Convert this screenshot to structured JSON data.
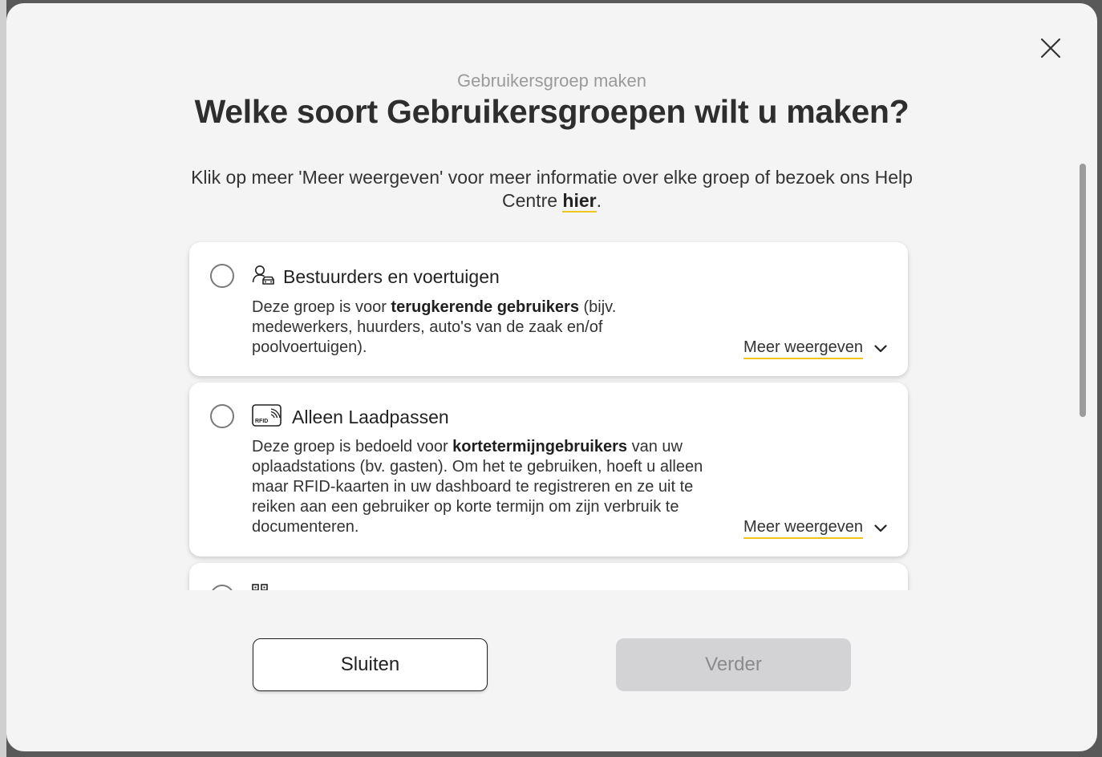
{
  "modal": {
    "subtitle": "Gebruikersgroep maken",
    "title": "Welke soort Gebruikersgroepen wilt u maken?",
    "intro_text": "Klik op meer 'Meer weergeven' voor meer informatie over elke groep of bezoek ons Help Centre ",
    "intro_link": "hier",
    "intro_end": "."
  },
  "cards": [
    {
      "icon": "person-car-icon",
      "title": "Bestuurders en voertuigen",
      "desc_pre": "Deze groep is voor ",
      "desc_bold": "terugkerende gebruikers",
      "desc_post": " (bijv. medewerkers, huurders, auto's van de zaak en/of poolvoertuigen).",
      "more_label": "Meer weergeven"
    },
    {
      "icon": "rfid-card-icon",
      "icon_text": "RFID",
      "title": "Alleen Laadpassen",
      "desc_pre": "Deze groep is bedoeld voor ",
      "desc_bold": "kortetermijngebruikers",
      "desc_post": " van uw oplaadstations (bv. gasten). Om het te gebruiken, hoeft u alleen maar RFID-kaarten in uw dashboard te registreren en ze uit te reiken aan een gebruiker op korte termijn om zijn verbruik te documenteren.",
      "more_label": "Meer weergeven"
    },
    {
      "icon": "qr-code-icon"
    }
  ],
  "buttons": {
    "close_label": "Sluiten",
    "next_label": "Verder"
  },
  "colors": {
    "accent_underline": "#f0c419",
    "disabled_button": "#d3d3d5",
    "modal_background": "#f4f4f4"
  }
}
